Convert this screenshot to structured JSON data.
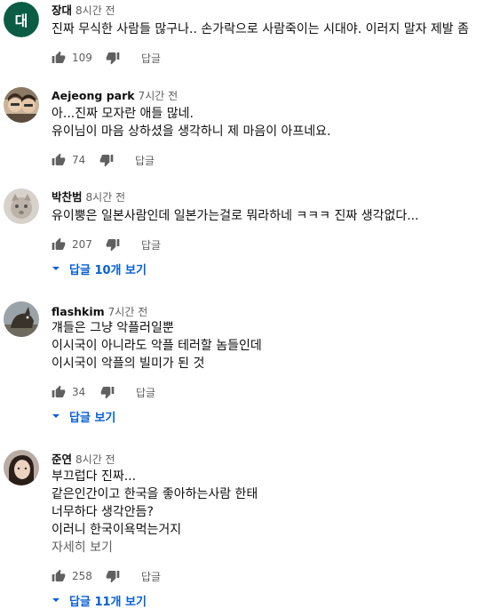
{
  "comments": [
    {
      "author": "장대",
      "time": "8시간 전",
      "avatar_letter": "대",
      "lines": [
        "진짜 무식한 사람들 많구나.. 손가락으로 사람죽이는 시대야. 이러지 말자 제발 좀"
      ],
      "likes": "109",
      "reply_label": "답글"
    },
    {
      "author": "Aejeong park",
      "time": "7시간 전",
      "lines": [
        "아...진짜 모자란 애들 많네.",
        "유이님이 마음 상하셨을 생각하니 제 마음이 아프네요."
      ],
      "likes": "74",
      "reply_label": "답글"
    },
    {
      "author": "박찬범",
      "time": "8시간 전",
      "lines": [
        "유이뿡은 일본사람인데 일본가는걸로 뭐라하네 ㅋㅋㅋ 진짜 생각없다..."
      ],
      "likes": "207",
      "reply_label": "답글",
      "replies_prefix": "답글 ",
      "replies_count": "10개",
      "replies_suffix": " 보기"
    },
    {
      "author": "flashkim",
      "time": "7시간 전",
      "lines": [
        "걔들은 그냥 악플러일뿐",
        "이시국이 아니라도 악플 테러할 놈들인데",
        "이시국이 악플의 빌미가 된 것"
      ],
      "likes": "34",
      "reply_label": "답글",
      "replies_text": "답글 보기"
    },
    {
      "author": "준연",
      "time": "8시간 전",
      "lines": [
        "부끄럽다 진짜...",
        "같은인간이고 한국을 좋아하는사람 한태",
        "너무하다 생각안듬?",
        "이러니 한국이욕먹는거지"
      ],
      "read_more": "자세히 보기",
      "likes": "258",
      "reply_label": "답글",
      "replies_prefix": "답글 ",
      "replies_count": "11개",
      "replies_suffix": " 보기"
    }
  ],
  "colors": {
    "text": "#0f0f0f",
    "meta": "#606060",
    "link": "#065fd4",
    "avatar_green": "#0b5c45"
  },
  "icons": {
    "like": "thumb-up-icon",
    "dislike": "thumb-down-icon",
    "expand": "caret-down-icon"
  }
}
